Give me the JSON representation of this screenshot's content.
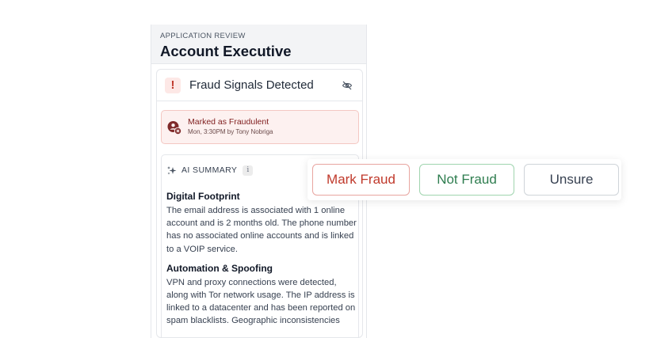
{
  "header": {
    "eyebrow": "APPLICATION REVIEW",
    "title": "Account Executive"
  },
  "fraud": {
    "icon_glyph": "!",
    "title": "Fraud Signals Detected",
    "marked_title": "Marked as Fraudulent",
    "marked_sub": "Mon, 3:30PM by Tony Nobriga"
  },
  "summary": {
    "label": "AI SUMMARY",
    "info_glyph": "i",
    "sections": [
      {
        "title": "Digital Footprint",
        "body": "The email address is associated with 1 online account and is 2 months old. The phone number has no associated online accounts and is linked to a VOIP service."
      },
      {
        "title": "Automation & Spoofing",
        "body": "VPN and proxy connections were detected, along with Tor network usage. The IP address is linked to a datacenter and has been reported on spam blacklists. Geographic inconsistencies"
      }
    ]
  },
  "actions": {
    "mark_fraud": "Mark Fraud",
    "not_fraud": "Not Fraud",
    "unsure": "Unsure"
  },
  "colors": {
    "fraud_red": "#c0392b",
    "success_green": "#2e7d4f",
    "header_bg": "#f3f4f6"
  }
}
